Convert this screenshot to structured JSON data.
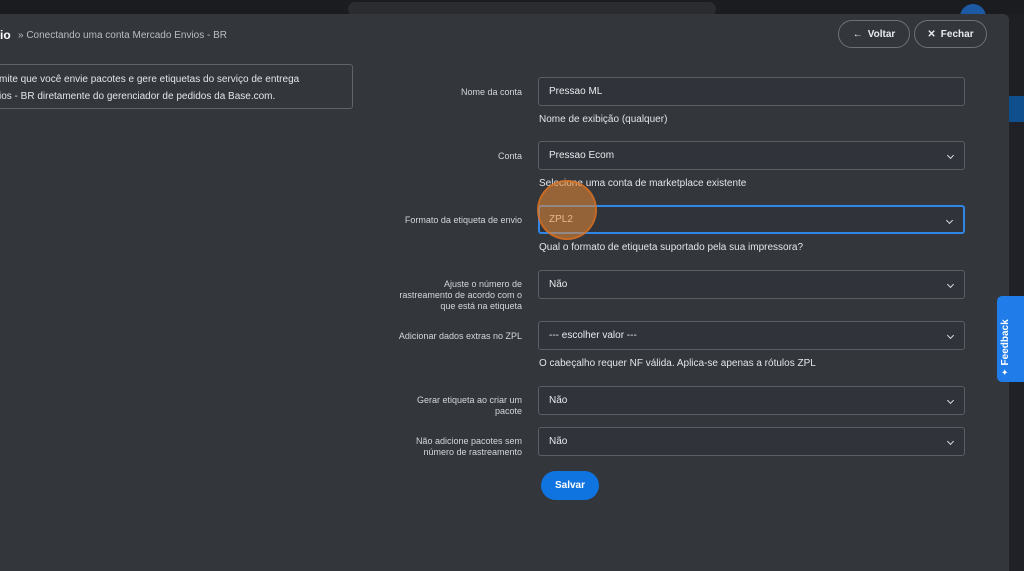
{
  "header": {
    "title_fragment": "io",
    "breadcrumb": "» Conectando uma conta Mercado Envios - BR",
    "back_label": "Voltar",
    "close_label": "Fechar",
    "back_icon": "arrow-left-icon",
    "close_icon": "close-icon"
  },
  "info": {
    "line1": "mite que você envie pacotes e gere etiquetas do serviço de entrega",
    "line2": "ios - BR diretamente do gerenciador de pedidos da Base.com."
  },
  "form": {
    "account_name": {
      "label": "Nome da conta",
      "value": "Pressao ML",
      "help": "Nome de exibição (qualquer)"
    },
    "account": {
      "label": "Conta",
      "value": "Pressao Ecom",
      "help": "Selecione uma conta de marketplace existente"
    },
    "label_format": {
      "label": "Formato da etiqueta de envio",
      "value": "ZPL2",
      "help": "Qual o formato de etiqueta suportado pela sua impressora?"
    },
    "tracking_adjust": {
      "label_line1": "Ajuste o número de",
      "label_line2": "rastreamento de acordo com o",
      "label_line3": "que está na etiqueta",
      "value": "Não"
    },
    "extra_zpl": {
      "label": "Adicionar dados extras no ZPL",
      "value": "--- escolher valor ---",
      "help": "O cabeçalho requer NF válida. Aplica-se apenas a rótulos ZPL"
    },
    "generate_label": {
      "label_line1": "Gerar etiqueta ao criar um",
      "label_line2": "pacote",
      "value": "Não"
    },
    "no_tracking": {
      "label_line1": "Não adicione pacotes sem",
      "label_line2": "número de rastreamento",
      "value": "Não"
    },
    "save_label": "Salvar"
  },
  "feedback": {
    "label": "Feedback",
    "icon": "sparkle-icon"
  },
  "colors": {
    "modal_bg": "#33363b",
    "accent": "#0f74e0",
    "focus": "#2f86e4",
    "cursor": "#e88b35"
  }
}
